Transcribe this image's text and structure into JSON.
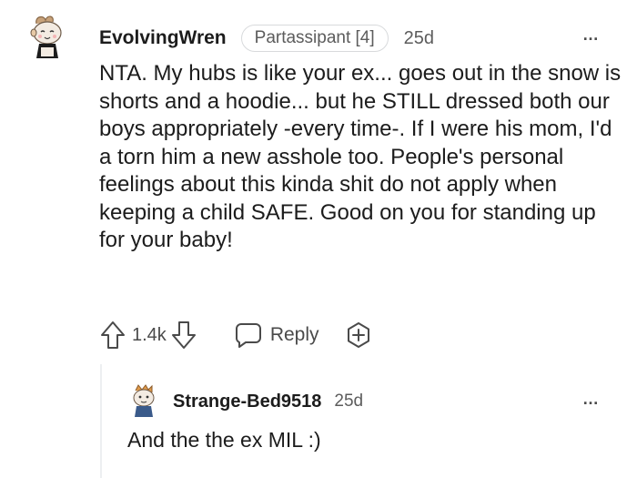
{
  "comments": [
    {
      "author": "EvolvingWren",
      "flair": "Partassipant [4]",
      "age": "25d",
      "body": "NTA. My hubs is like your ex... goes out in the snow is shorts and a hoodie... but he STILL dressed both our boys appropriately -every time-. If I were his mom, I'd a torn him a new asshole too. People's personal feelings about this kinda shit do not apply when keeping a child SAFE. Good on you for standing up for your baby!",
      "vote_count": "1.4k",
      "reply_label": "Reply",
      "more_icon": "…"
    },
    {
      "author": "Strange-Bed9518",
      "age": "25d",
      "body": "And the the ex MIL :)",
      "more_icon": "…"
    }
  ],
  "colors": {
    "text": "#1c1c1c",
    "meta": "#5c5c5c",
    "icon": "#4a4a4a",
    "flair_border": "#d8dadc",
    "thread_line": "#edeff1"
  }
}
